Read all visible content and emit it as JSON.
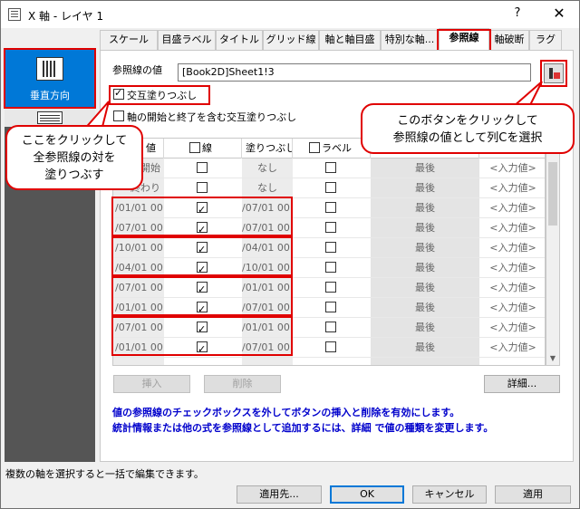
{
  "window": {
    "title": "X 軸 - レイヤ 1",
    "help": "?",
    "close": "✕"
  },
  "sidebar": {
    "selected_label": "垂直方向"
  },
  "tabs": [
    "スケール",
    "目盛ラベル",
    "タイトル",
    "グリッド線",
    "軸と軸目盛",
    "特別な軸...",
    "参照線",
    "軸破断",
    "ラグ"
  ],
  "active_tab": "参照線",
  "ref": {
    "label": "参照線の値",
    "value": "[Book2D]Sheet1!3"
  },
  "options": {
    "alternate_fill": "交互塗りつぶし",
    "include_start_end": "軸の開始と終了を含む交互塗りつぶし"
  },
  "grid": {
    "headers": {
      "value": "値",
      "line": "線",
      "fill": "塗りつぶし",
      "label": "ラベル"
    },
    "rows": [
      {
        "value": "開始",
        "line": false,
        "fill": "なし",
        "label": false,
        "pos": "最後",
        "input": "<入力値>"
      },
      {
        "value": "終わり",
        "line": false,
        "fill": "なし",
        "label": false,
        "pos": "最後",
        "input": "<入力値>"
      },
      {
        "value": "/01/01 00:",
        "line": true,
        "fill": "/07/01 00:0",
        "label": false,
        "pos": "最後",
        "input": "<入力値>"
      },
      {
        "value": "/07/01 00:",
        "line": true,
        "fill": "/07/01 00:0",
        "label": false,
        "pos": "最後",
        "input": "<入力値>"
      },
      {
        "value": "/10/01 00:",
        "line": true,
        "fill": "/04/01 00:0",
        "label": false,
        "pos": "最後",
        "input": "<入力値>"
      },
      {
        "value": "/04/01 00:",
        "line": true,
        "fill": "/10/01 00:0",
        "label": false,
        "pos": "最後",
        "input": "<入力値>"
      },
      {
        "value": "/07/01 00:",
        "line": true,
        "fill": "/01/01 00:0",
        "label": false,
        "pos": "最後",
        "input": "<入力値>"
      },
      {
        "value": "/01/01 00:",
        "line": true,
        "fill": "/07/01 00:0",
        "label": false,
        "pos": "最後",
        "input": "<入力値>"
      },
      {
        "value": "/07/01 00:",
        "line": true,
        "fill": "/01/01 00:0",
        "label": false,
        "pos": "最後",
        "input": "<入力値>"
      },
      {
        "value": "/01/01 00:",
        "line": true,
        "fill": "/07/01 00:0",
        "label": false,
        "pos": "最後",
        "input": "<入力値>"
      },
      {
        "value": "",
        "line": false,
        "fill": "",
        "label": false,
        "pos": "",
        "input": ""
      }
    ]
  },
  "buttons": {
    "insert": "挿入",
    "delete": "削除",
    "details": "詳細...",
    "apply_to": "適用先...",
    "ok": "OK",
    "cancel": "キャンセル",
    "apply": "適用"
  },
  "help_lines": [
    "値の参照線のチェックボックスを外してボタンの挿入と削除を有効にします。",
    "統計情報または他の式を参照線として追加するには、詳細 で値の種類を変更します。"
  ],
  "status": "複数の軸を選択すると一括で編集できます。",
  "callouts": {
    "left": [
      "ここをクリックして",
      "全参照線の対を",
      "塗りつぶす"
    ],
    "right": [
      "このボタンをクリックして",
      "参照線の値として列Cを選択"
    ]
  }
}
